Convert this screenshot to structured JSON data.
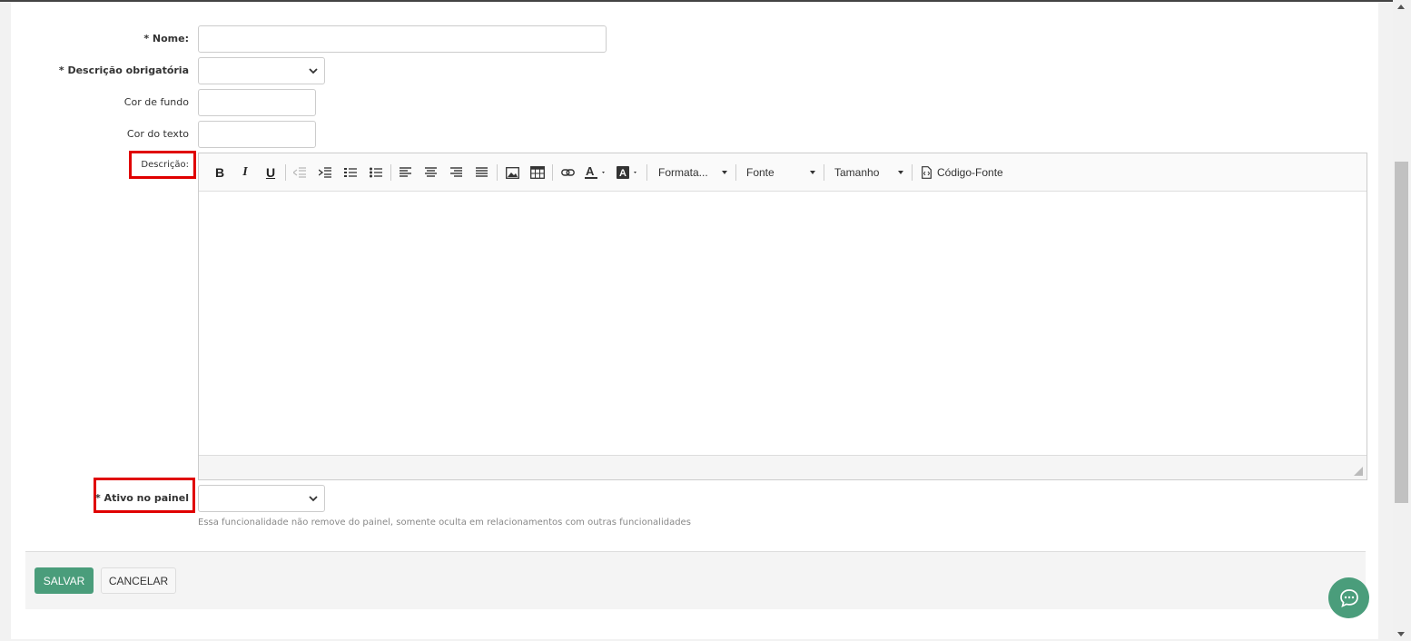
{
  "form": {
    "nome_label": "* Nome:",
    "descricao_obrigatoria_label": "* Descrição obrigatória",
    "cor_fundo_label": "Cor de fundo",
    "cor_texto_label": "Cor do texto",
    "descricao_label": "Descrição:",
    "ativo_label": "* Ativo no painel",
    "ativo_help": "Essa funcionalidade não remove do painel, somente oculta em relacionamentos com outras funcionalidades"
  },
  "editor": {
    "bold": "B",
    "italic": "I",
    "underline": "U",
    "format_dropdown": "Formata...",
    "font_dropdown": "Fonte",
    "size_dropdown": "Tamanho",
    "source_button": "Código-Fonte"
  },
  "footer": {
    "save_label": "SALVAR",
    "cancel_label": "CANCELAR"
  },
  "colors": {
    "accent": "#4a9d7b",
    "highlight": "#e00000"
  }
}
